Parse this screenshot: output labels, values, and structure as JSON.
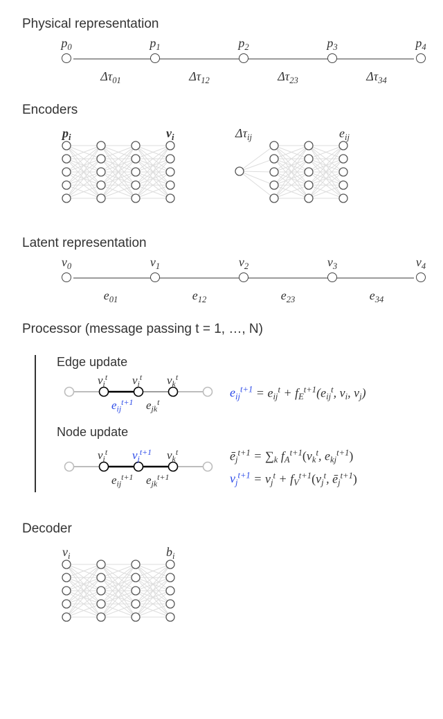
{
  "titles": {
    "physical": "Physical representation",
    "encoders": "Encoders",
    "latent": "Latent representation",
    "processor": "Processor (message passing t = 1, …, N)",
    "edge_update": "Edge update",
    "node_update": "Node update",
    "decoder": "Decoder"
  },
  "chains": {
    "physical": {
      "top": [
        "p<sub class='sub'>0</sub>",
        "p<sub class='sub'>1</sub>",
        "p<sub class='sub'>2</sub>",
        "p<sub class='sub'>3</sub>",
        "p<sub class='sub'>4</sub>"
      ],
      "bot": [
        "Δτ<sub class='sub'>01</sub>",
        "Δτ<sub class='sub'>12</sub>",
        "Δτ<sub class='sub'>23</sub>",
        "Δτ<sub class='sub'>34</sub>"
      ]
    },
    "latent": {
      "top": [
        "v<sub class='sub'>0</sub>",
        "v<sub class='sub'>1</sub>",
        "v<sub class='sub'>2</sub>",
        "v<sub class='sub'>3</sub>",
        "v<sub class='sub'>4</sub>"
      ],
      "bot": [
        "e<sub class='sub'>01</sub>",
        "e<sub class='sub'>12</sub>",
        "e<sub class='sub'>23</sub>",
        "e<sub class='sub'>34</sub>"
      ]
    }
  },
  "encoders": {
    "node": {
      "in_label": "p<sub class='sub'>i</sub>",
      "out_label": "v<sub class='sub'>i</sub>",
      "bold": true
    },
    "edge": {
      "in_label": "Δτ<sub class='sub'>ij</sub>",
      "out_label": "e<sub class='sub'>ij</sub>",
      "bold": false
    }
  },
  "decoder": {
    "in_label": "v<sub class='sub'>i</sub>",
    "out_label": "b<sub class='sub'>i</sub>"
  },
  "processor": {
    "edge": {
      "top": [
        "v<sub class='sub'>i</sub><sup class='sup'>t</sup>",
        "v<sub class='sub'>j</sub><sup class='sup'>t</sup>",
        "v<sub class='sub'>k</sub><sup class='sup'>t</sup>"
      ],
      "bot": [
        "<span class='blue'>e<sub class='sub'>ij</sub><sup class='sup'>t+1</sup></span>",
        "e<sub class='sub'>jk</sub><sup class='sup'>t</sup>"
      ],
      "eq": "<span class='blue'>e<sub class='sub'>ij</sub><sup class='sup'>t+1</sup></span> = e<sub class='sub'>ij</sub><sup class='sup'>t</sup> + f<sub class='sub'>E</sub><sup class='sup'>t+1</sup>(e<sub class='sub'>ij</sub><sup class='sup'>t</sup>, v<sub class='sub'>i</sub>, v<sub class='sub'>j</sub>)"
    },
    "node": {
      "top": [
        "v<sub class='sub'>i</sub><sup class='sup'>t</sup>",
        "<span class='blue'>v<sub class='sub'>j</sub><sup class='sup'>t+1</sup></span>",
        "v<sub class='sub'>k</sub><sup class='sup'>t</sup>"
      ],
      "bot": [
        "e<sub class='sub'>ij</sub><sup class='sup'>t+1</sup>",
        "e<sub class='sub'>jk</sub><sup class='sup'>t+1</sup>"
      ],
      "eq1": "ē<sub class='sub'>j</sub><sup class='sup'>t+1</sup> = ∑<sub class='sub'>k</sub> f<sub class='sub'>A</sub><sup class='sup'>t+1</sup><span class='upright'>(</span>v<sub class='sub'>k</sub><sup class='sup'>t</sup>, e<sub class='sub'>kj</sub><sup class='sup'>t+1</sup><span class='upright'>)</span>",
      "eq2": "<span class='blue'>v<sub class='sub'>j</sub><sup class='sup'>t+1</sup></span> = v<sub class='sub'>j</sub><sup class='sup'>t</sup> + f<sub class='sub'>V</sub><sup class='sup'>t+1</sup><span class='upright'>(</span>v<sub class='sub'>j</sub><sup class='sup'>t</sup>, ē<sub class='sub'>j</sub><sup class='sup'>t+1</sup><span class='upright'>)</span>"
    }
  }
}
